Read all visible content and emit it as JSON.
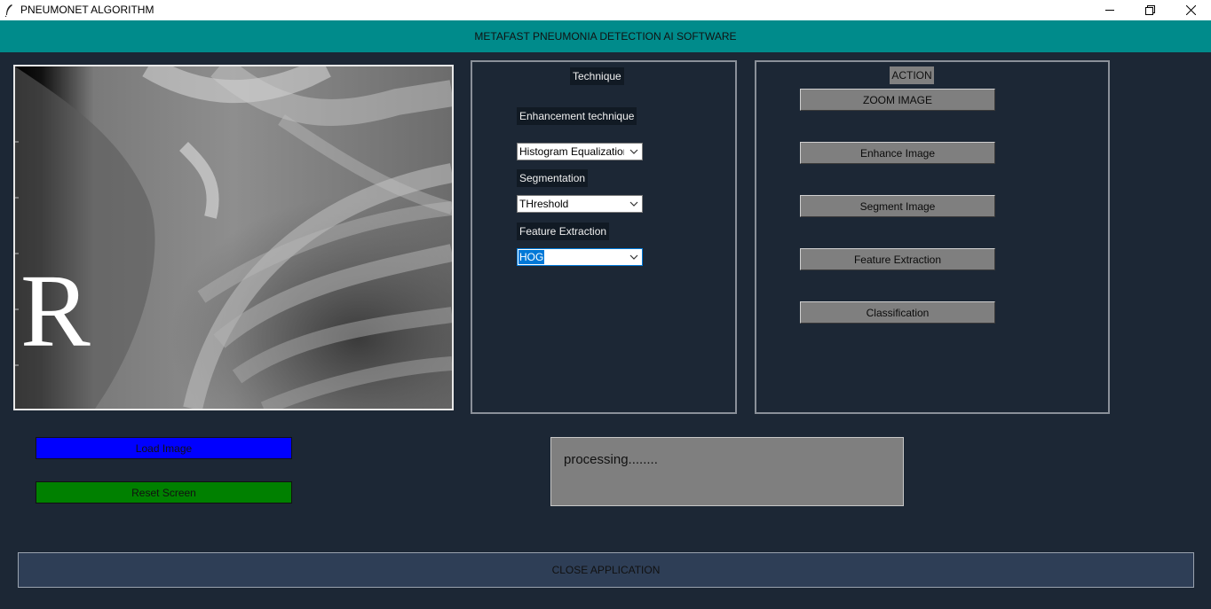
{
  "window": {
    "title": "PNEUMONET ALGORITHM",
    "app_icon": "feather-icon",
    "controls": [
      "minimize-icon",
      "restore-icon",
      "close-icon"
    ]
  },
  "header": {
    "title": "METAFAST PNEUMONIA DETECTION AI SOFTWARE",
    "color": "#008b8b"
  },
  "image": {
    "marker": "R",
    "description_icon": "chest-xray-image"
  },
  "technique": {
    "heading": "Technique",
    "enhancement_label": "Enhancement technique",
    "enhancement_value": "Histogram Equalization",
    "segmentation_label": "Segmentation",
    "segmentation_value": "THreshold",
    "feature_label": "Feature Extraction",
    "feature_value": "HOG"
  },
  "action": {
    "heading": "ACTION",
    "buttons": [
      "ZOOM IMAGE",
      "Enhance Image",
      "Segment Image",
      "Feature Extraction",
      "Classification"
    ]
  },
  "controls": {
    "load_label": "Load Image",
    "load_color": "#0000ff",
    "reset_label": "Reset Screen",
    "reset_color": "#008000"
  },
  "status": {
    "text": "processing........"
  },
  "footer": {
    "close_label": "CLOSE APPLICATION"
  }
}
